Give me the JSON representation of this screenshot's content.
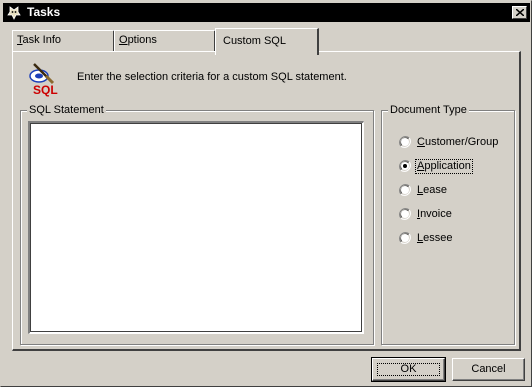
{
  "window": {
    "title": "Tasks",
    "icon": "app-logo-icon",
    "close_icon": "close-icon"
  },
  "tabs": [
    {
      "label_first": "T",
      "label_rest": "ask Info",
      "active": false
    },
    {
      "label_first": "O",
      "label_rest": "ptions",
      "active": false
    },
    {
      "label_first": "",
      "label_rest": "Custom SQL",
      "active": true
    }
  ],
  "header": {
    "icon": "sql-icon",
    "icon_text": "SQL",
    "instruction": "Enter the selection criteria for a custom SQL statement."
  },
  "sql_group": {
    "label": "SQL Statement",
    "value": ""
  },
  "doc_type": {
    "label": "Document Type",
    "options": [
      {
        "first": "C",
        "rest": "ustomer/Group",
        "selected": false
      },
      {
        "first": "A",
        "rest": "pplication",
        "selected": true
      },
      {
        "first": "L",
        "rest": "ease",
        "selected": false
      },
      {
        "first": "I",
        "rest": "nvoice",
        "selected": false
      },
      {
        "first": "L",
        "rest": "essee",
        "selected": false
      }
    ]
  },
  "buttons": {
    "ok": "OK",
    "cancel": "Cancel"
  },
  "colors": {
    "face": "#d4d0c8",
    "titlebar": "#000000",
    "sql_red": "#cc0000",
    "sql_blue": "#1c3fb8"
  }
}
